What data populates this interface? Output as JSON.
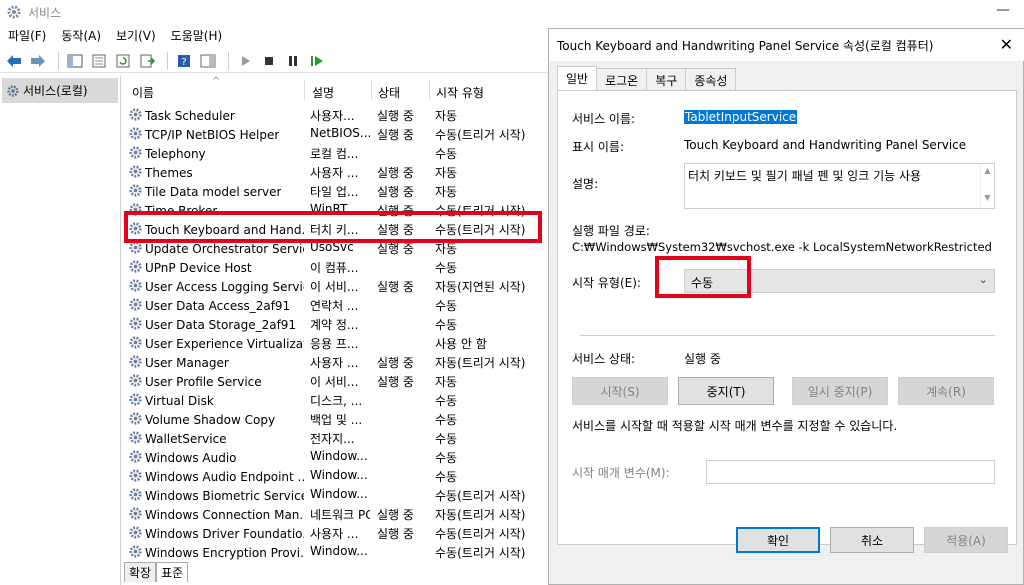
{
  "window": {
    "title": "서비스",
    "minimize": "—"
  },
  "menu": [
    "파일(F)",
    "동작(A)",
    "보기(V)",
    "도움말(H)"
  ],
  "tree": {
    "root": "서비스(로컬)"
  },
  "columns": {
    "name": "이름",
    "desc": "설명",
    "status": "상태",
    "startup": "시작 유형"
  },
  "services": [
    {
      "name": "Task Scheduler",
      "desc": "사용자...",
      "status": "실행 중",
      "startup": "자동"
    },
    {
      "name": "TCP/IP NetBIOS Helper",
      "desc": "NetBIOS...",
      "status": "실행 중",
      "startup": "수동(트리거 시작)"
    },
    {
      "name": "Telephony",
      "desc": "로컬 컴...",
      "status": "",
      "startup": "수동"
    },
    {
      "name": "Themes",
      "desc": "사용자 ...",
      "status": "실행 중",
      "startup": "자동"
    },
    {
      "name": "Tile Data model server",
      "desc": "타일 업...",
      "status": "실행 중",
      "startup": "자동"
    },
    {
      "name": "Time Broker",
      "desc": "WinRT ...",
      "status": "실행 중",
      "startup": "수동(트리거 시작)"
    },
    {
      "name": "Touch Keyboard and Hand...",
      "desc": "터치 키...",
      "status": "실행 중",
      "startup": "수동(트리거 시작)"
    },
    {
      "name": "Update Orchestrator Servic...",
      "desc": "UsoSvc",
      "status": "실행 중",
      "startup": "자동"
    },
    {
      "name": "UPnP Device Host",
      "desc": "이 컴퓨...",
      "status": "",
      "startup": "수동"
    },
    {
      "name": "User Access Logging Service",
      "desc": "이 서비...",
      "status": "실행 중",
      "startup": "자동(지연된 시작)"
    },
    {
      "name": "User Data Access_2af91",
      "desc": "연락처 ...",
      "status": "",
      "startup": "수동"
    },
    {
      "name": "User Data Storage_2af91",
      "desc": "계약 정...",
      "status": "",
      "startup": "수동"
    },
    {
      "name": "User Experience Virtualizati...",
      "desc": "응용 프...",
      "status": "",
      "startup": "사용 안 함"
    },
    {
      "name": "User Manager",
      "desc": "사용자 ...",
      "status": "실행 중",
      "startup": "자동(트리거 시작)"
    },
    {
      "name": "User Profile Service",
      "desc": "이 서비...",
      "status": "실행 중",
      "startup": "자동"
    },
    {
      "name": "Virtual Disk",
      "desc": "디스크, ...",
      "status": "",
      "startup": "수동"
    },
    {
      "name": "Volume Shadow Copy",
      "desc": "백업 및 ...",
      "status": "",
      "startup": "수동"
    },
    {
      "name": "WalletService",
      "desc": "전자지...",
      "status": "",
      "startup": "수동"
    },
    {
      "name": "Windows Audio",
      "desc": "Window...",
      "status": "",
      "startup": "수동"
    },
    {
      "name": "Windows Audio Endpoint ...",
      "desc": "Window...",
      "status": "",
      "startup": "수동"
    },
    {
      "name": "Windows Biometric Service",
      "desc": "Window...",
      "status": "",
      "startup": "수동(트리거 시작)"
    },
    {
      "name": "Windows Connection Man...",
      "desc": "네트워크 PC...",
      "status": "실행 중",
      "startup": "자동(트리거 시작)"
    },
    {
      "name": "Windows Driver Foundatio...",
      "desc": "사용자 ...",
      "status": "실행 중",
      "startup": "수동(트리거 시작)"
    },
    {
      "name": "Windows Encryption Provi...",
      "desc": "Window...",
      "status": "",
      "startup": "수동(트리거 시작)"
    }
  ],
  "bottom_tabs": [
    "확장",
    "표준"
  ],
  "dialog": {
    "title": "Touch Keyboard and Handwriting Panel Service 속성(로컬 컴퓨터)",
    "tabs": [
      "일반",
      "로그온",
      "복구",
      "종속성"
    ],
    "service_name_label": "서비스 이름:",
    "service_name": "TabletInputService",
    "display_name_label": "표시 이름:",
    "display_name": "Touch Keyboard and Handwriting Panel Service",
    "description_label": "설명:",
    "description": "터치 키보드 및 필기 패널 펜 및 잉크 기능 사용",
    "exe_path_label": "실행 파일 경로:",
    "exe_path": "C:₩Windows₩System32₩svchost.exe -k LocalSystemNetworkRestricted",
    "startup_label": "시작 유형(E):",
    "startup_value": "수동",
    "status_label": "서비스 상태:",
    "status_value": "실행 중",
    "start_btn": "시작(S)",
    "stop_btn": "중지(T)",
    "pause_btn": "일시 중지(P)",
    "resume_btn": "계속(R)",
    "params_note": "서비스를 시작할 때 적용할 시작 매개 변수를 지정할 수 있습니다.",
    "params_label": "시작 매개 변수(M):",
    "ok_btn": "확인",
    "cancel_btn": "취소",
    "apply_btn": "적용(A)"
  }
}
